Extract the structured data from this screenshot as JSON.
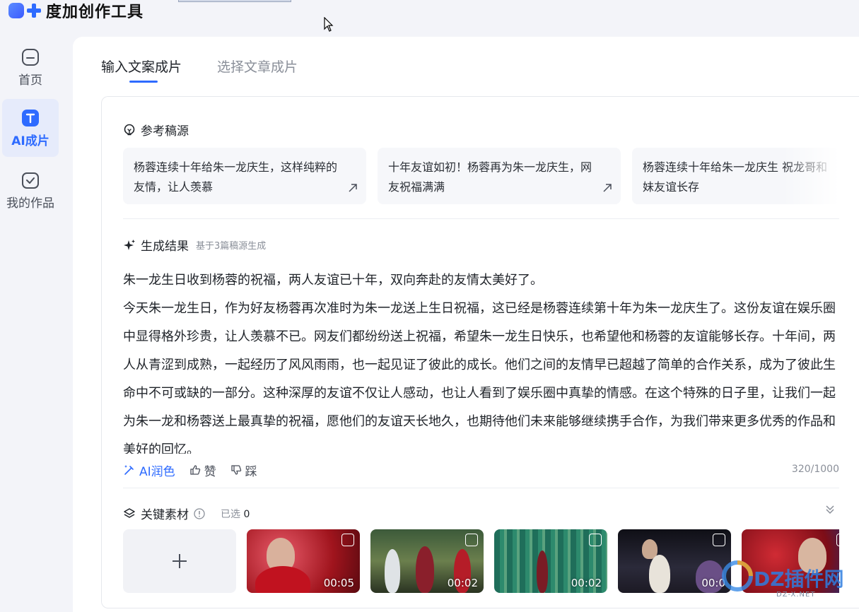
{
  "app": {
    "title": "度加创作工具"
  },
  "nav": {
    "items": [
      {
        "label": "首页",
        "icon": "home-icon"
      },
      {
        "label": "AI成片",
        "icon": "ai-video-icon",
        "active": true
      },
      {
        "label": "我的作品",
        "icon": "my-works-icon"
      }
    ]
  },
  "tabs": [
    {
      "label": "输入文案成片",
      "active": true
    },
    {
      "label": "选择文章成片",
      "active": false
    }
  ],
  "sources": {
    "title": "参考稿源",
    "items": [
      "杨蓉连续十年给朱一龙庆生，这样纯粹的友情，让人羡慕",
      "十年友谊如初！杨蓉再为朱一龙庆生，网友祝福满满",
      "杨蓉连续十年给朱一龙庆生 祝龙哥和妹友谊长存"
    ]
  },
  "result": {
    "title": "生成结果",
    "subtitle": "基于3篇稿源生成",
    "paragraphs": [
      "朱一龙生日收到杨蓉的祝福，两人友谊已十年，双向奔赴的友情太美好了。",
      "今天朱一龙生日，作为好友杨蓉再次准时为朱一龙送上生日祝福，这已经是杨蓉连续第十年为朱一龙庆生了。这份友谊在娱乐圈中显得格外珍贵，让人羡慕不已。网友们都纷纷送上祝福，希望朱一龙生日快乐，也希望他和杨蓉的友谊能够长存。十年间，两人从青涩到成熟，一起经历了风风雨雨，也一起见证了彼此的成长。他们之间的友情早已超越了简单的合作关系，成为了彼此生命中不可或缺的一部分。这种深厚的友谊不仅让人感动，也让人看到了娱乐圈中真挚的情感。在这个特殊的日子里，让我们一起为朱一龙和杨蓉送上最真挚的祝福，愿他们的友谊天长地久，也期待他们未来能够继续携手合作，为我们带来更多优秀的作品和美好的回忆。"
    ],
    "actions": {
      "polish": "AI润色",
      "like": "赞",
      "dislike": "踩"
    },
    "char_count": "320/1000"
  },
  "materials": {
    "title": "关键素材",
    "selected_label": "已选",
    "selected_count": "0",
    "durations": [
      "00:05",
      "00:02",
      "00:02",
      "00:0",
      ""
    ]
  },
  "watermark": {
    "text": "DZ插件网",
    "sub": "DZ-X.NET"
  }
}
